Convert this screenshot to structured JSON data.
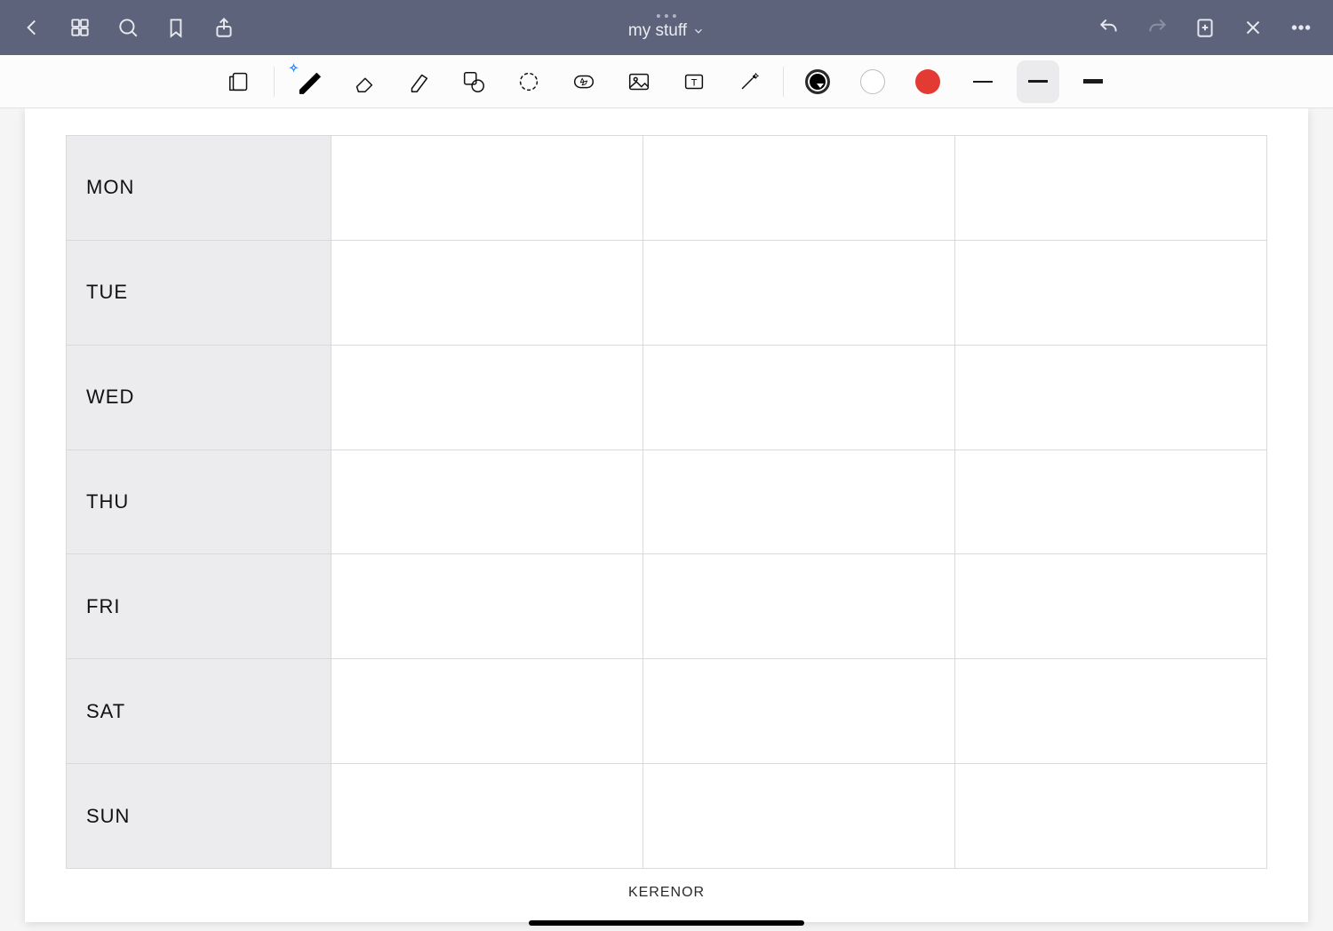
{
  "header": {
    "title": "my stuff"
  },
  "toolbar": {
    "colors": {
      "black": "#000000",
      "white": "#ffffff",
      "red": "#e33a33"
    },
    "stroke_widths": [
      1,
      2,
      3
    ],
    "selected_stroke_index": 1
  },
  "planner": {
    "days": [
      "MON",
      "TUE",
      "WED",
      "THU",
      "FRI",
      "SAT",
      "SUN"
    ],
    "columns": 3
  },
  "footer": {
    "brand": "KERENOR"
  }
}
